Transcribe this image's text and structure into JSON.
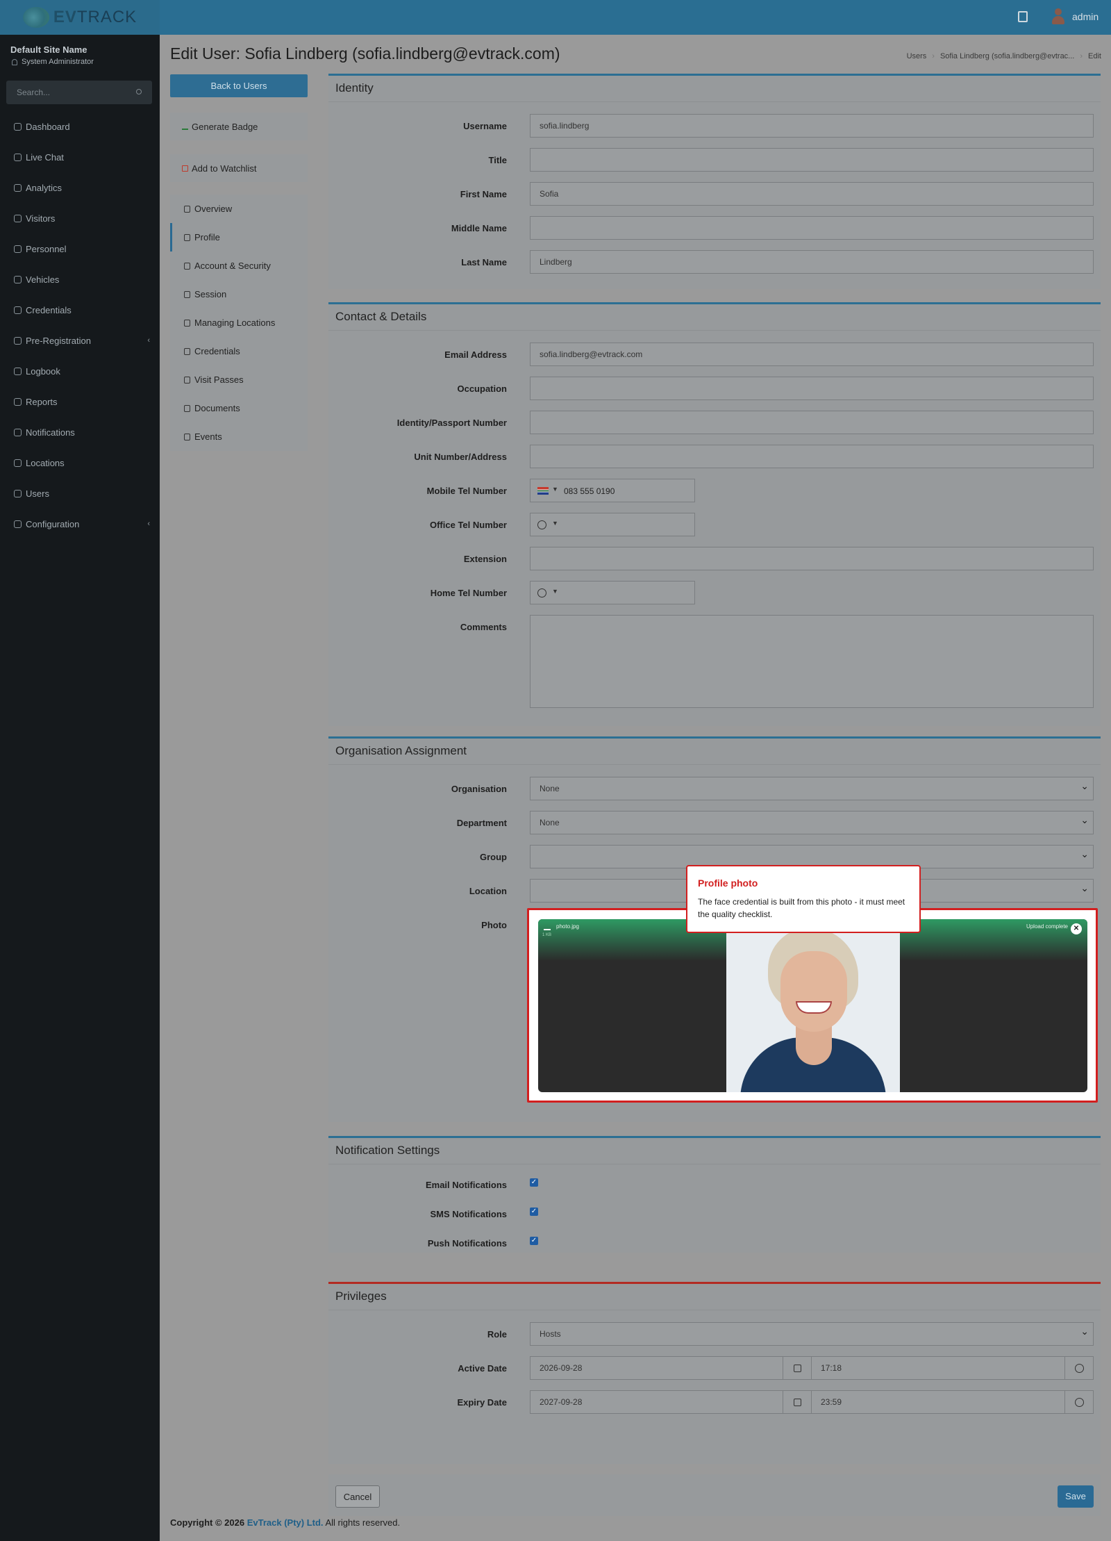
{
  "header": {
    "logo_bold": "EV",
    "logo_rest": "TRACK",
    "user": "admin"
  },
  "sidebar": {
    "site_name": "Default Site Name",
    "role": "System Administrator",
    "search_placeholder": "Search...",
    "items": [
      {
        "label": "Dashboard"
      },
      {
        "label": "Live Chat"
      },
      {
        "label": "Analytics"
      },
      {
        "label": "Visitors"
      },
      {
        "label": "Personnel"
      },
      {
        "label": "Vehicles"
      },
      {
        "label": "Credentials"
      },
      {
        "label": "Pre-Registration"
      },
      {
        "label": "Logbook"
      },
      {
        "label": "Reports"
      },
      {
        "label": "Notifications"
      },
      {
        "label": "Locations"
      },
      {
        "label": "Users"
      },
      {
        "label": "Configuration"
      }
    ]
  },
  "page": {
    "title": "Edit User: Sofia Lindberg (sofia.lindberg@evtrack.com)",
    "breadcrumbs": [
      "Users",
      "Sofia Lindberg (sofia.lindberg@evtrac...",
      "Edit"
    ]
  },
  "actions_side": {
    "back": "Back to Users",
    "badge": "Generate Badge",
    "watchlist": "Add to Watchlist"
  },
  "subnav": [
    "Overview",
    "Profile",
    "Account & Security",
    "Session",
    "Managing Locations",
    "Credentials",
    "Visit Passes",
    "Documents",
    "Events"
  ],
  "identity": {
    "title": "Identity",
    "username_label": "Username",
    "username": "sofia.lindberg",
    "title_label": "Title",
    "title_value": "",
    "first_label": "First Name",
    "first": "Sofia",
    "middle_label": "Middle Name",
    "middle": "",
    "last_label": "Last Name",
    "last": "Lindberg"
  },
  "contact": {
    "title": "Contact & Details",
    "email_label": "Email Address",
    "email": "sofia.lindberg@evtrack.com",
    "occupation_label": "Occupation",
    "id_label": "Identity/Passport Number",
    "unit_label": "Unit Number/Address",
    "mobile_label": "Mobile Tel Number",
    "mobile": "083 555 0190",
    "office_label": "Office Tel Number",
    "ext_label": "Extension",
    "home_label": "Home Tel Number",
    "comments_label": "Comments"
  },
  "org": {
    "title": "Organisation Assignment",
    "organisation_label": "Organisation",
    "organisation": "None",
    "department_label": "Department",
    "department": "None",
    "group_label": "Group",
    "location_label": "Location",
    "photo_label": "Photo",
    "photo_file": "photo.jpg",
    "photo_size": "1 KB",
    "photo_status": "Upload complete"
  },
  "tooltip": {
    "title": "Profile photo",
    "body": "The face credential is built from this photo - it must meet the quality checklist."
  },
  "notif": {
    "title": "Notification Settings",
    "email_label": "Email Notifications",
    "sms_label": "SMS Notifications",
    "push_label": "Push Notifications"
  },
  "priv": {
    "title": "Privileges",
    "role_label": "Role",
    "role": "Hosts",
    "active_label": "Active Date",
    "active_date": "2026-09-28",
    "active_time": "17:18",
    "expiry_label": "Expiry Date",
    "expiry_date": "2027-09-28",
    "expiry_time": "23:59"
  },
  "footer": {
    "cancel": "Cancel",
    "save": "Save",
    "copyright_pre": "Copyright © 2026",
    "company": "EvTrack (Pty) Ltd.",
    "rights": "All rights reserved."
  }
}
